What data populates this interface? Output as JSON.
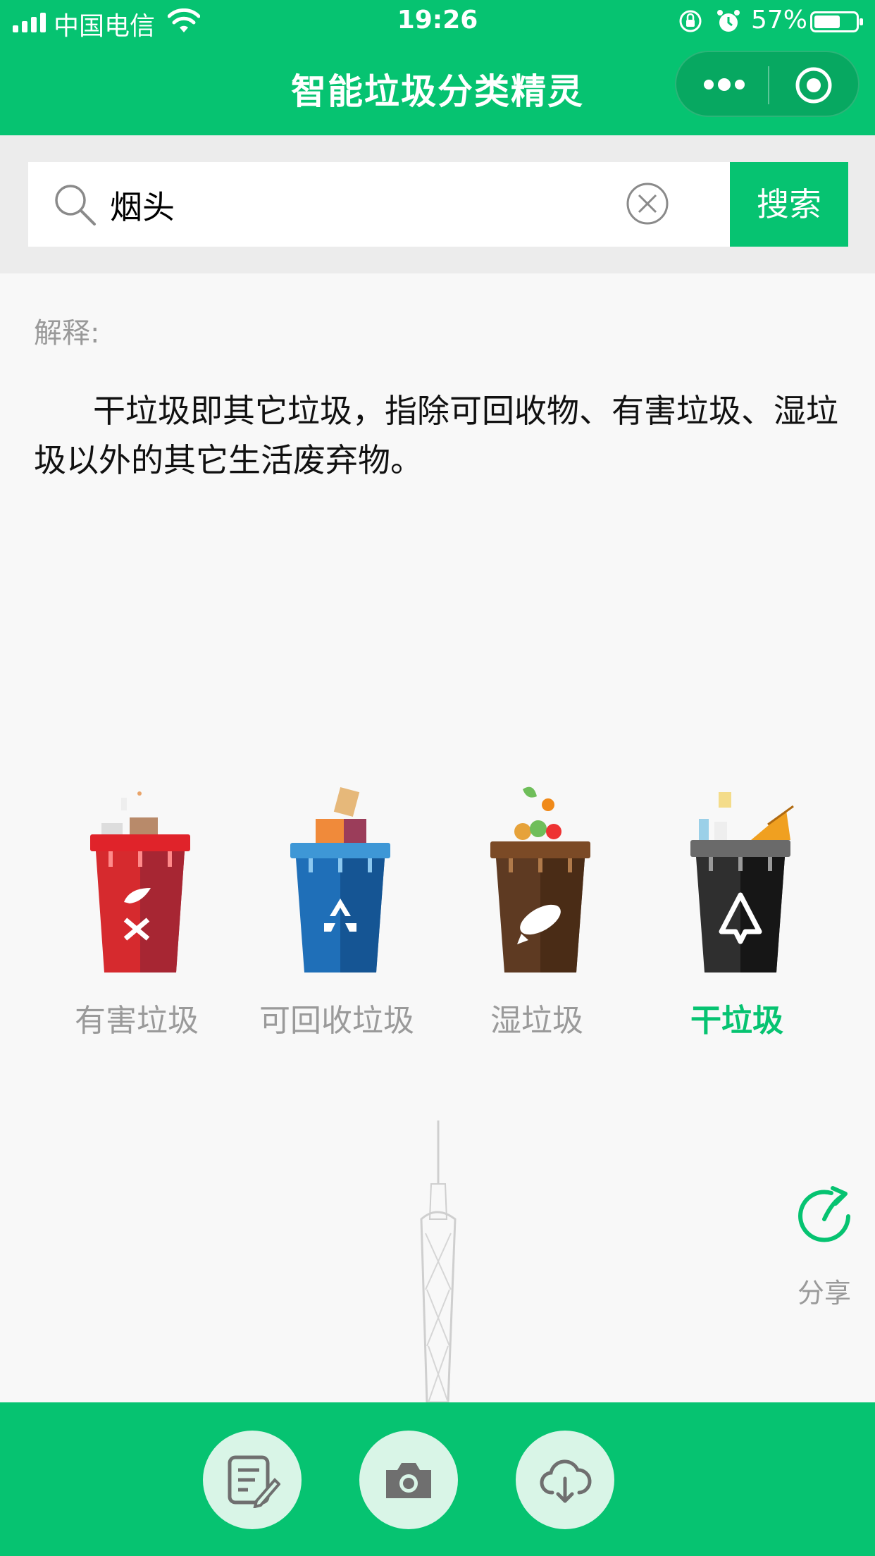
{
  "status_bar": {
    "carrier": "中国电信",
    "time": "19:26",
    "battery": "57%"
  },
  "navbar": {
    "title": "智能垃圾分类精灵"
  },
  "search": {
    "value": "烟头",
    "button_label": "搜索"
  },
  "explanation": {
    "label": "解释:",
    "text": "干垃圾即其它垃圾，指除可回收物、有害垃圾、湿垃圾以外的其它生活废弃物。"
  },
  "bins": [
    {
      "label": "有害垃圾",
      "icon": "hazardous-bin-icon",
      "color": "#d62a2e",
      "active": false
    },
    {
      "label": "可回收垃圾",
      "icon": "recyclable-bin-icon",
      "color": "#1a69b3",
      "active": false
    },
    {
      "label": "湿垃圾",
      "icon": "wet-bin-icon",
      "color": "#5e3a22",
      "active": false
    },
    {
      "label": "干垃圾",
      "icon": "dry-bin-icon",
      "color": "#262626",
      "active": true
    }
  ],
  "share": {
    "label": "分享"
  },
  "bottom_actions": [
    {
      "icon": "edit-note-icon"
    },
    {
      "icon": "camera-icon"
    },
    {
      "icon": "cloud-download-icon"
    }
  ],
  "colors": {
    "brand": "#06c371",
    "active_label": "#06c371",
    "inactive_label": "#9a9a9a"
  }
}
